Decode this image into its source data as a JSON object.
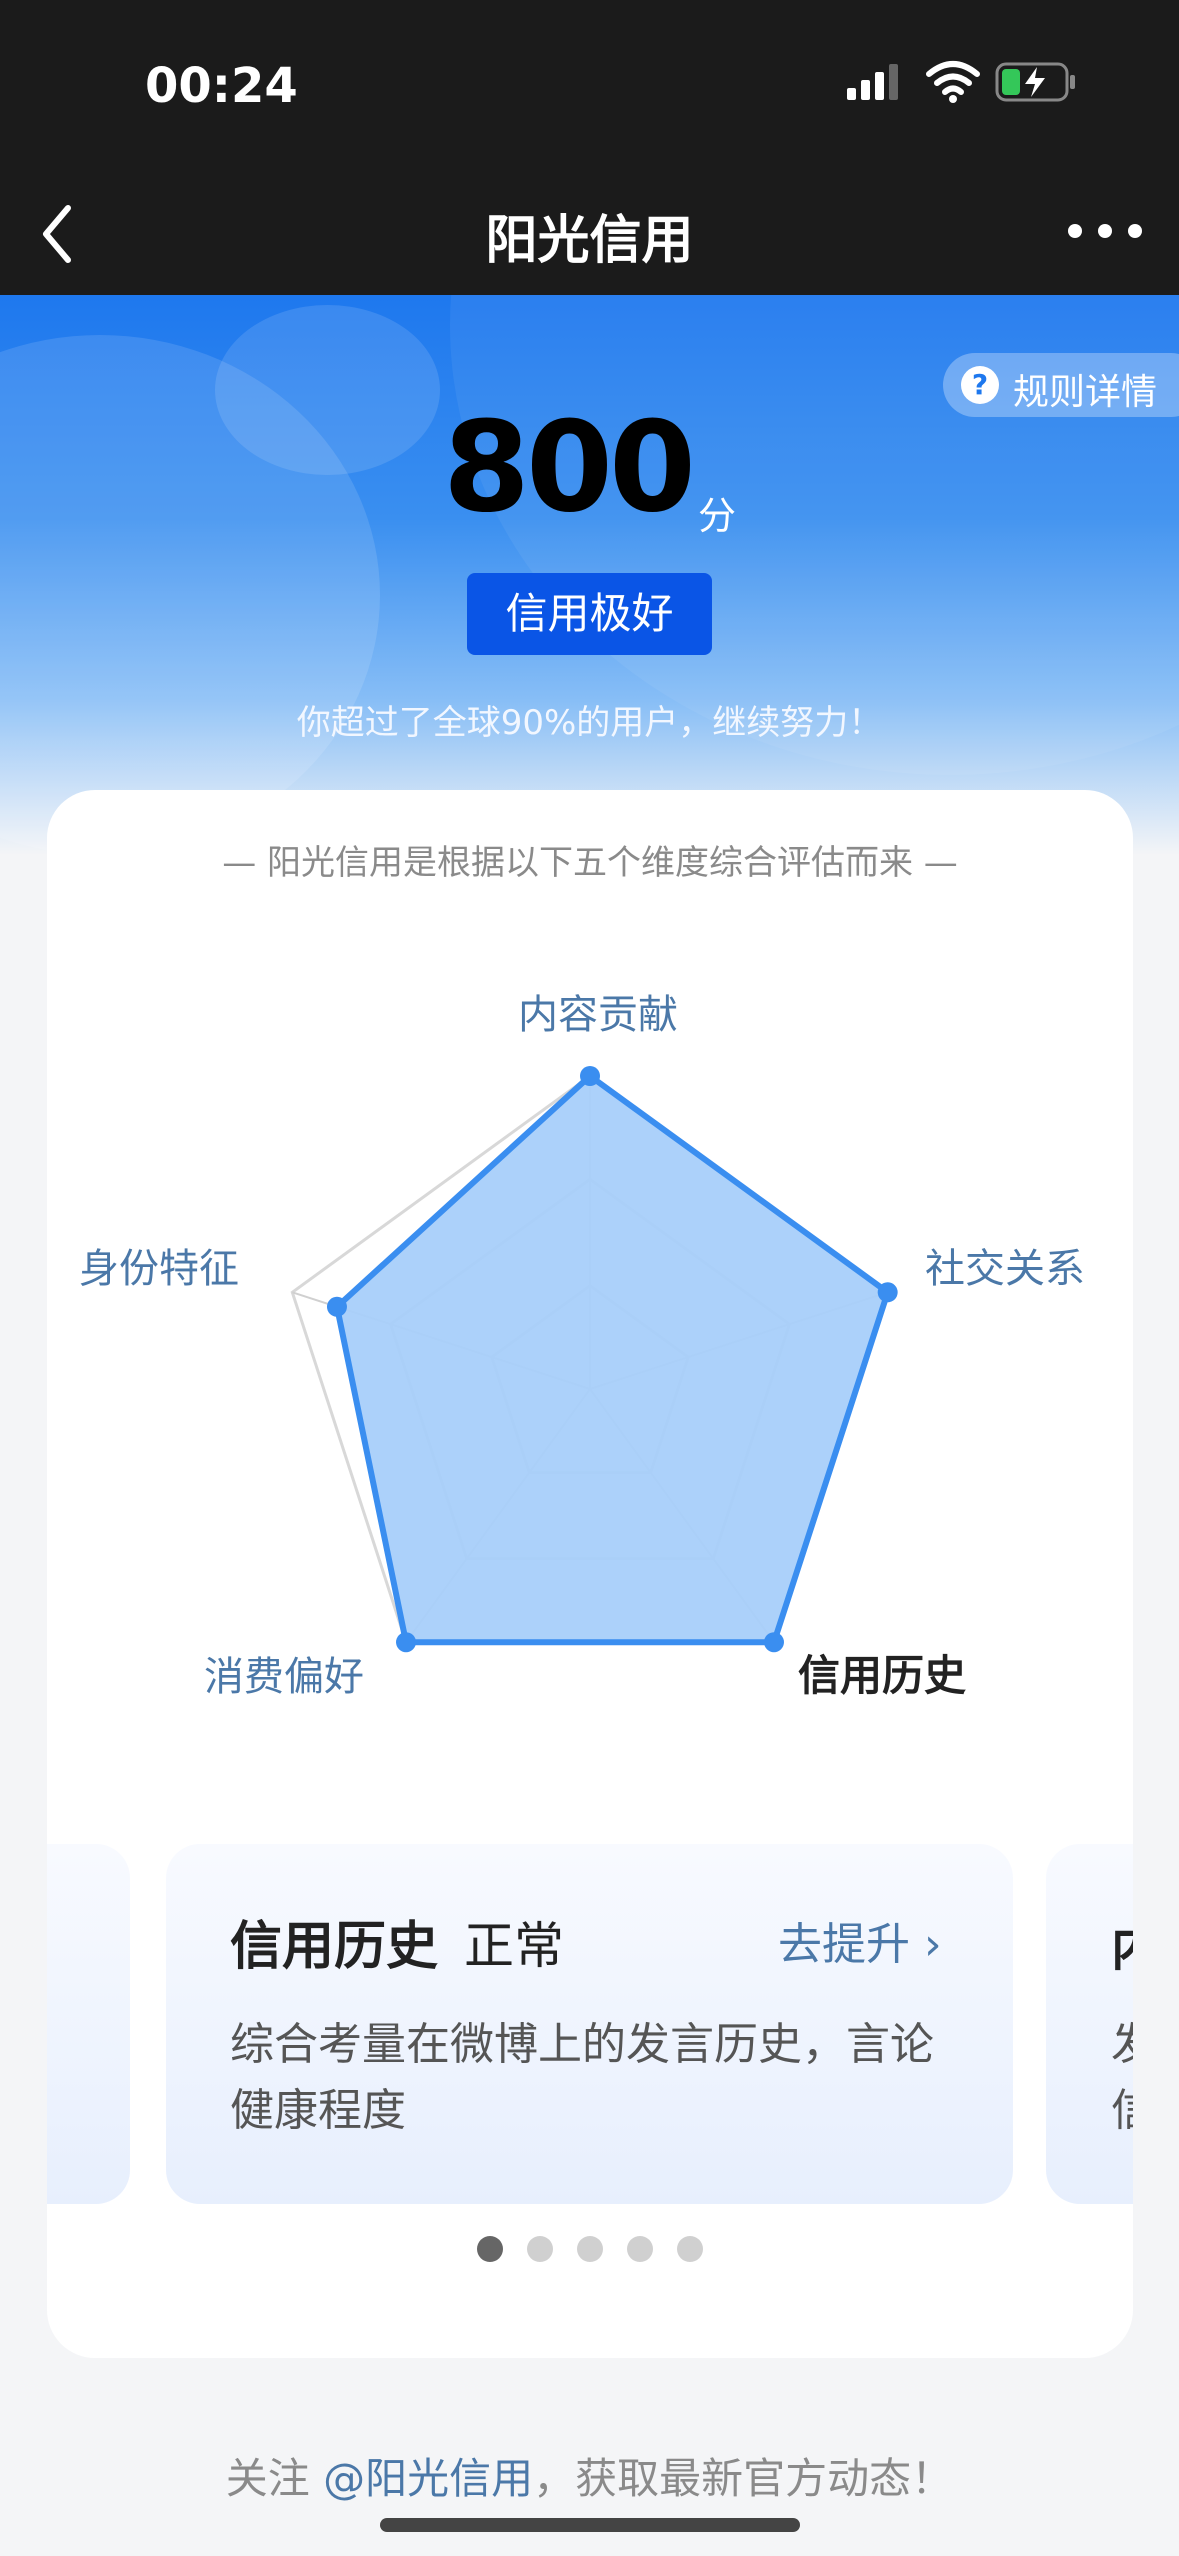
{
  "status_bar": {
    "time": "00:24"
  },
  "nav": {
    "title": "阳光信用"
  },
  "hero": {
    "rules_label": "规则详情",
    "score": "800",
    "score_unit": "分",
    "level_badge": "信用极好",
    "subtitle": "你超过了全球90%的用户，继续努力！"
  },
  "card": {
    "title": "— 阳光信用是根据以下五个维度综合评估而来 —",
    "dimensions": [
      "内容贡献",
      "社交关系",
      "信用历史",
      "消费偏好",
      "身份特征"
    ],
    "active_dimension": "信用历史",
    "radar_values": [
      1.0,
      1.0,
      1.0,
      1.0,
      0.85
    ]
  },
  "slides": {
    "current": {
      "title": "信用历史",
      "status": "正常",
      "improve": "去提升",
      "description": "综合考量在微博上的发言历史，言论健康程度"
    },
    "next_peek": {
      "title": "内",
      "description": "发信"
    },
    "page_count": 5,
    "active_index": 0
  },
  "footer": {
    "prefix": "关注 ",
    "link": "@阳光信用",
    "suffix": "，获取最新官方动态！"
  },
  "colors": {
    "accent": "#3a8ef0",
    "radar_fill": "#a8cffa",
    "badge": "#0a55e6",
    "label_blue": "#4b78a8"
  }
}
